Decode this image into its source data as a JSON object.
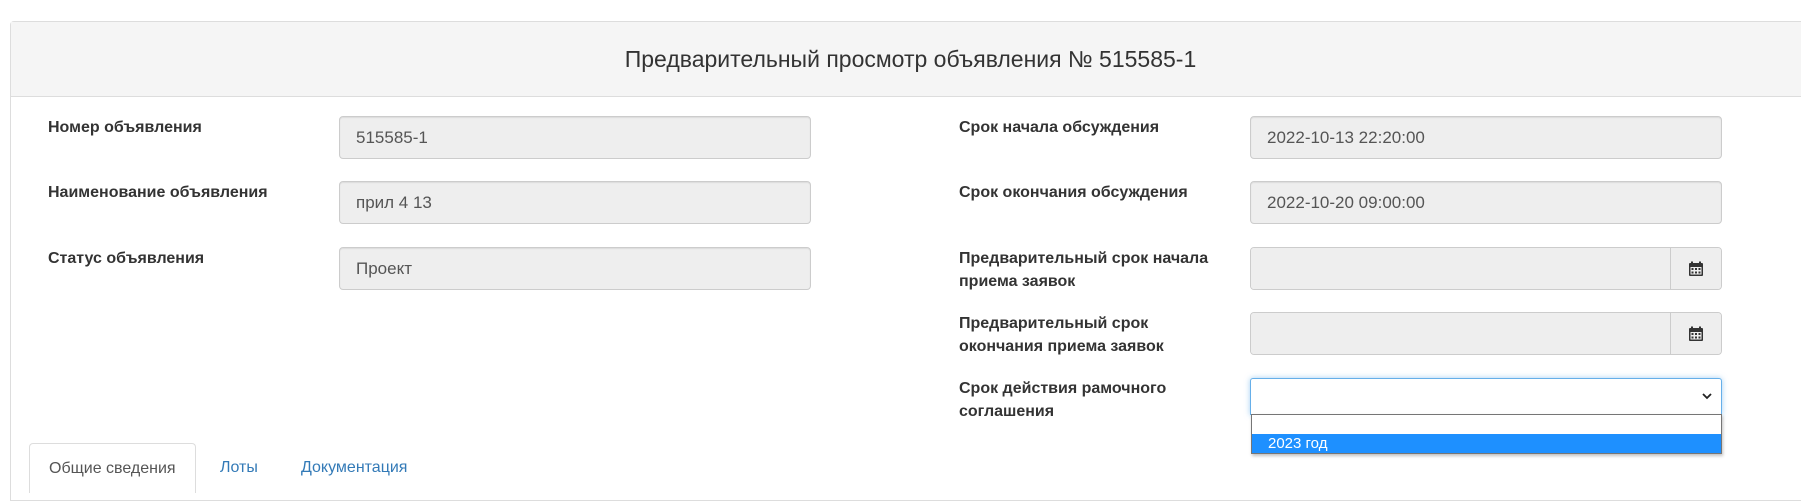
{
  "header": {
    "title": "Предварительный просмотр объявления № 515585-1"
  },
  "left_fields": [
    {
      "label": "Номер объявления",
      "value": "515585-1"
    },
    {
      "label": "Наименование объявления",
      "value": "прил 4 13"
    },
    {
      "label": "Статус объявления",
      "value": "Проект"
    }
  ],
  "right_fields": {
    "discussion_start": {
      "label": "Срок начала обсуждения",
      "value": "2022-10-13 22:20:00"
    },
    "discussion_end": {
      "label": "Срок окончания обсуждения",
      "value": "2022-10-20 09:00:00"
    },
    "prelim_start": {
      "label_line1": "Предварительный срок начала",
      "label_line2": "приема заявок",
      "value": ""
    },
    "prelim_end": {
      "label_line1": "Предварительный срок",
      "label_line2": "окончания приема заявок",
      "value": ""
    },
    "framework_term": {
      "label_line1": "Срок действия рамочного",
      "label_line2": "соглашения",
      "selected": "",
      "options": [
        "",
        "2023 год"
      ],
      "highlighted_option": "2023 год"
    }
  },
  "tabs": [
    {
      "label": "Общие сведения",
      "active": true
    },
    {
      "label": "Лоты",
      "active": false
    },
    {
      "label": "Документация",
      "active": false
    }
  ],
  "colors": {
    "link": "#337ab7",
    "highlight": "#1e90ff",
    "focus_border": "#66afe9",
    "readonly_bg": "#eeeeee"
  },
  "icons": {
    "calendar": "calendar-icon",
    "chevron": "chevron-down-icon"
  }
}
